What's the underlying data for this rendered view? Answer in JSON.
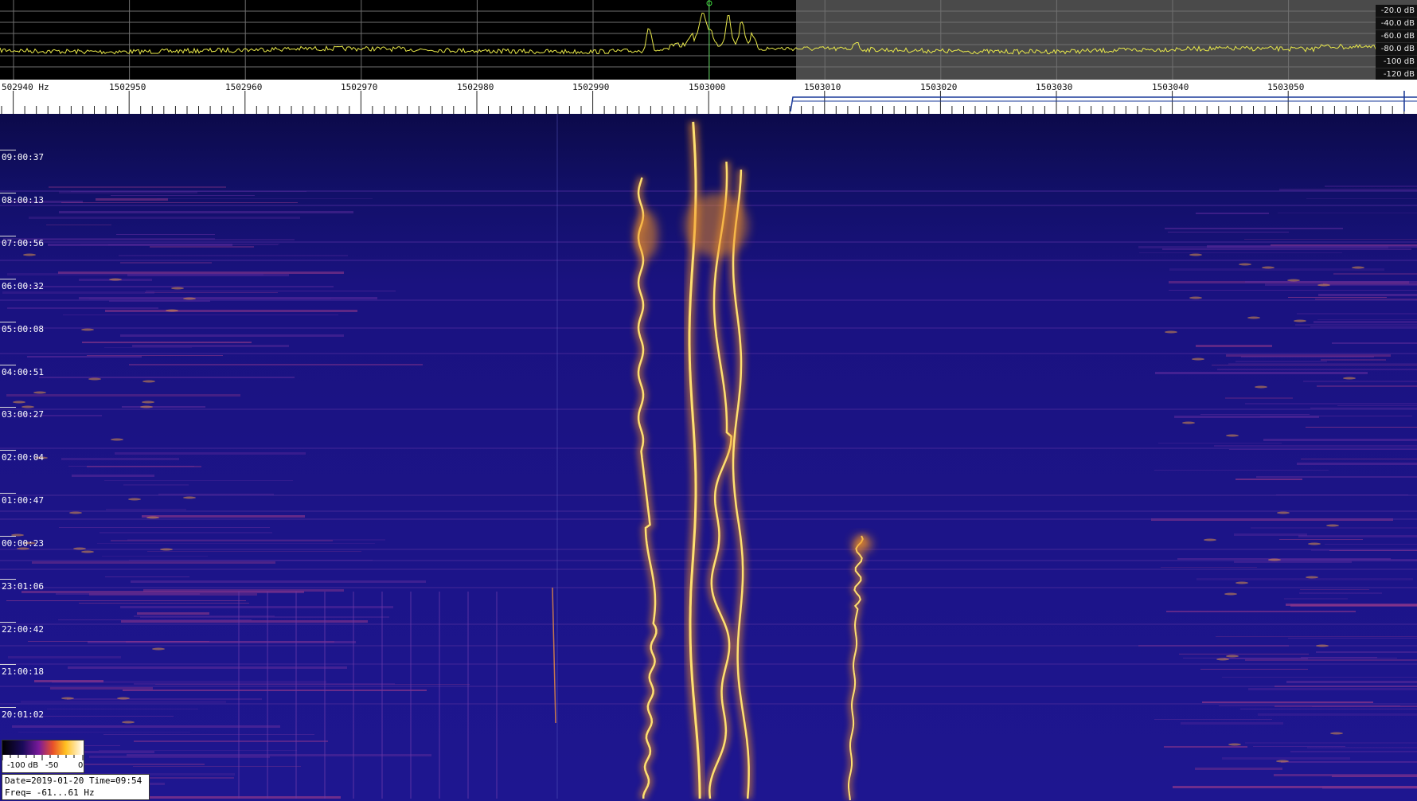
{
  "spectrum": {
    "db_scale": [
      "-20.0 dB",
      "-40.0 dB",
      "-60.0 dB",
      "-80.0 dB",
      "-100 dB",
      "-120 dB"
    ],
    "colors": {
      "trace": "#e8e84a",
      "background": "#000000",
      "shade": "#4a4a4a",
      "grid": "#707070",
      "marker": "#40e040"
    }
  },
  "frequency_axis": {
    "labels": [
      "502940 Hz",
      "1502950",
      "1502960",
      "1502970",
      "1502980",
      "1502990",
      "1503000",
      "1503010",
      "1503020",
      "1503030",
      "1503040",
      "1503050"
    ]
  },
  "waterfall": {
    "time_labels": [
      "09:00:37",
      "08:00:13",
      "07:00:56",
      "06:00:32",
      "05:00:08",
      "04:00:51",
      "03:00:27",
      "02:00:04",
      "01:00:47",
      "00:00:23",
      "23:01:06",
      "22:00:42",
      "21:00:18",
      "20:01:02"
    ],
    "colors": {
      "background": "#1a1280",
      "trace_core": "#ffe070",
      "trace_glow": "#f09020"
    }
  },
  "colorbar": {
    "labels": [
      "-100 dB",
      "-50",
      "0"
    ]
  },
  "info": {
    "line1": "Date=2019-01-20 Time=09:54",
    "line2": "Freq= -61...61 Hz"
  }
}
